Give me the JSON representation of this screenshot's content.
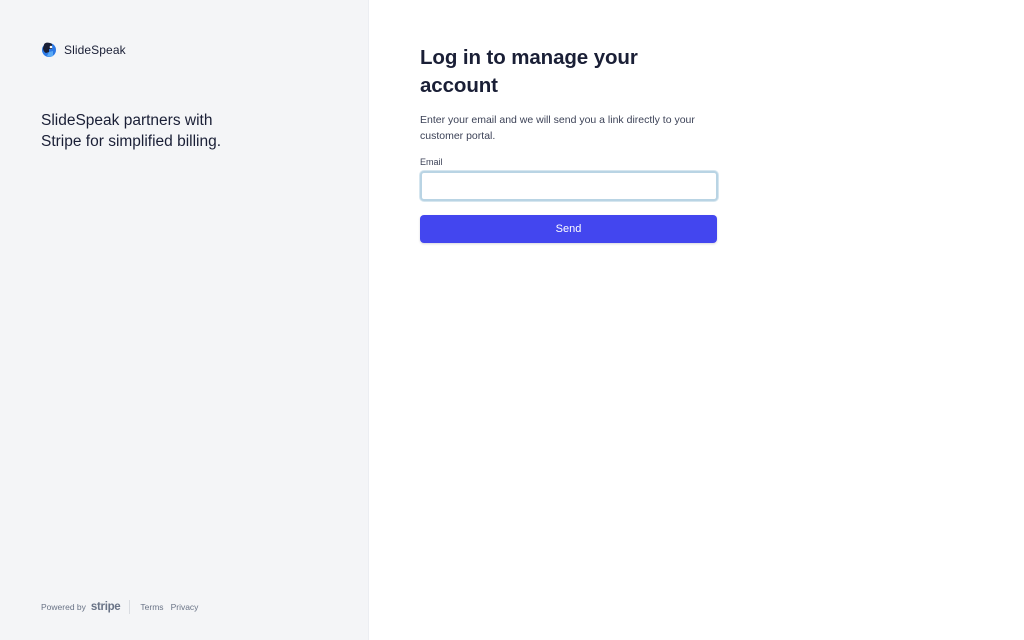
{
  "brand": {
    "name": "SlideSpeak",
    "logo_icon": "slidespeak-logo-icon"
  },
  "left": {
    "tagline": "SlideSpeak partners with Stripe for simplified billing."
  },
  "footer": {
    "powered_by": "Powered by",
    "stripe_logo": "stripe",
    "terms": "Terms",
    "privacy": "Privacy"
  },
  "form": {
    "title": "Log in to manage your account",
    "description": "Enter your email and we will send you a link directly to your customer portal.",
    "email_label": "Email",
    "email_value": "",
    "email_placeholder": "",
    "send_label": "Send"
  },
  "colors": {
    "accent": "#4346ef",
    "left_background": "#f4f5f7",
    "text": "#1a1f36",
    "input_focus_border": "#b9d4e4"
  }
}
